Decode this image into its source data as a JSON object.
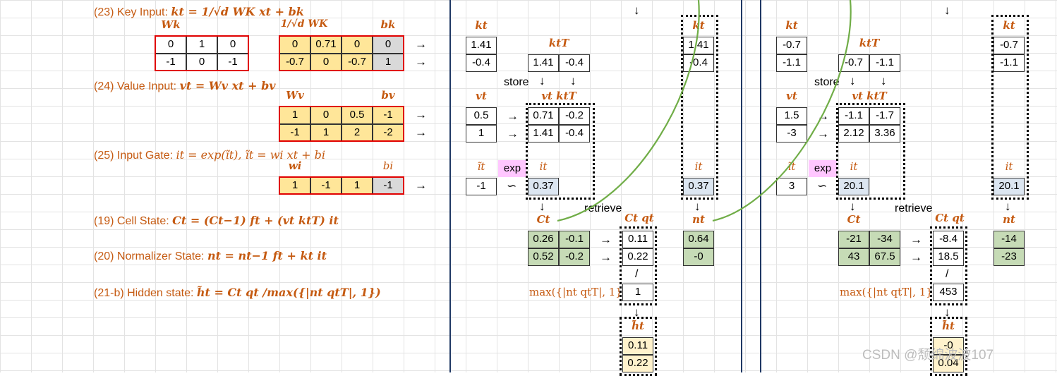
{
  "equations": {
    "eq23": {
      "label": "(23) Key Input:",
      "formula": "kt = 1/√d WK xt + bk"
    },
    "eq24": {
      "label": "(24) Value Input:",
      "formula": "vt = Wv xt + bv"
    },
    "eq25": {
      "label": "(25) Input Gate:",
      "formula": "it = exp(ĩt),  ĩt = wi xt + bi"
    },
    "eq19": {
      "label": "(19) Cell State:",
      "formula": "Ct = (Ct−1) ft + (vt ktT) it"
    },
    "eq20": {
      "label": "(20) Normalizer State:",
      "formula": "nt = nt−1 ft + kt it"
    },
    "eq21": {
      "label": "(21-b) Hidden state:",
      "formula": "h̃t = Ct qt /max({|nt qtT|, 1})"
    }
  },
  "headers": {
    "Wk": "Wk",
    "WK_scaled": "1/√d WK",
    "bk": "bk",
    "Wv": "Wv",
    "bv": "bv",
    "wi": "wi",
    "bi": "bi",
    "kt": "kt",
    "ktT": "ktT",
    "vt": "vt",
    "vtktT": "vt ktT",
    "it_tilde": "ĩt",
    "it": "it",
    "Ct": "Ct",
    "Ctqt": "Ct qt",
    "nt": "nt",
    "ht": "h̃t",
    "max": "max({|nt qtT|, 1})"
  },
  "matrices": {
    "Wk": [
      [
        "0",
        "1",
        "0"
      ],
      [
        "-1",
        "0",
        "-1"
      ]
    ],
    "WK_scaled": [
      [
        "0",
        "0.71",
        "0"
      ],
      [
        "-0.7",
        "0",
        "-0.7"
      ]
    ],
    "bk": [
      "0",
      "1"
    ],
    "Wv": [
      [
        "1",
        "0",
        "0.5"
      ],
      [
        "-1",
        "1",
        "2"
      ]
    ],
    "bv": [
      "-1",
      "-2"
    ],
    "wi": [
      "1",
      "-1",
      "1"
    ],
    "bi": "-1"
  },
  "steps": [
    {
      "kt": [
        "1.41",
        "-0.4"
      ],
      "ktT": [
        "1.41",
        "-0.4"
      ],
      "vt": [
        "0.5",
        "1"
      ],
      "vtktT": [
        [
          "0.71",
          "-0.2"
        ],
        [
          "1.41",
          "-0.4"
        ]
      ],
      "it_tilde": "-1",
      "it": "0.37",
      "Ct": [
        [
          "0.26",
          "-0.1"
        ],
        [
          "0.52",
          "-0.2"
        ]
      ],
      "Ctqt": [
        "0.11",
        "0.22"
      ],
      "kt_right": [
        "1.41",
        "-0.4"
      ],
      "it_right": "0.37",
      "nt": [
        "0.64",
        "-0"
      ],
      "max": "1",
      "ht": [
        "0.11",
        "0.22"
      ]
    },
    {
      "kt": [
        "-0.7",
        "-1.1"
      ],
      "ktT": [
        "-0.7",
        "-1.1"
      ],
      "vt": [
        "1.5",
        "-3"
      ],
      "vtktT": [
        [
          "-1.1",
          "-1.7"
        ],
        [
          "2.12",
          "3.36"
        ]
      ],
      "it_tilde": "3",
      "it": "20.1",
      "Ct": [
        [
          "-21",
          "-34"
        ],
        [
          "43",
          "67.5"
        ]
      ],
      "Ctqt": [
        "-8.4",
        "18.5"
      ],
      "kt_right": [
        "-0.7",
        "-1.1"
      ],
      "it_right": "20.1",
      "nt": [
        "-14",
        "-23"
      ],
      "max": "453",
      "ht": [
        "-0",
        "0.04"
      ]
    }
  ],
  "labels": {
    "store": "store",
    "retrieve": "retrieve",
    "exp": "exp",
    "divide": "/",
    "tilde_op": "∽"
  },
  "symbols": {
    "arrow_right": "→",
    "arrow_down": "↓"
  },
  "watermark": "CSDN @颓绵波波107",
  "colors": {
    "accent": "#c55a11",
    "yellow": "#ffe699",
    "green": "#c6dbb6",
    "blue": "#dce6f1",
    "pink": "#ffc7ff",
    "curve": "#70ad47"
  }
}
